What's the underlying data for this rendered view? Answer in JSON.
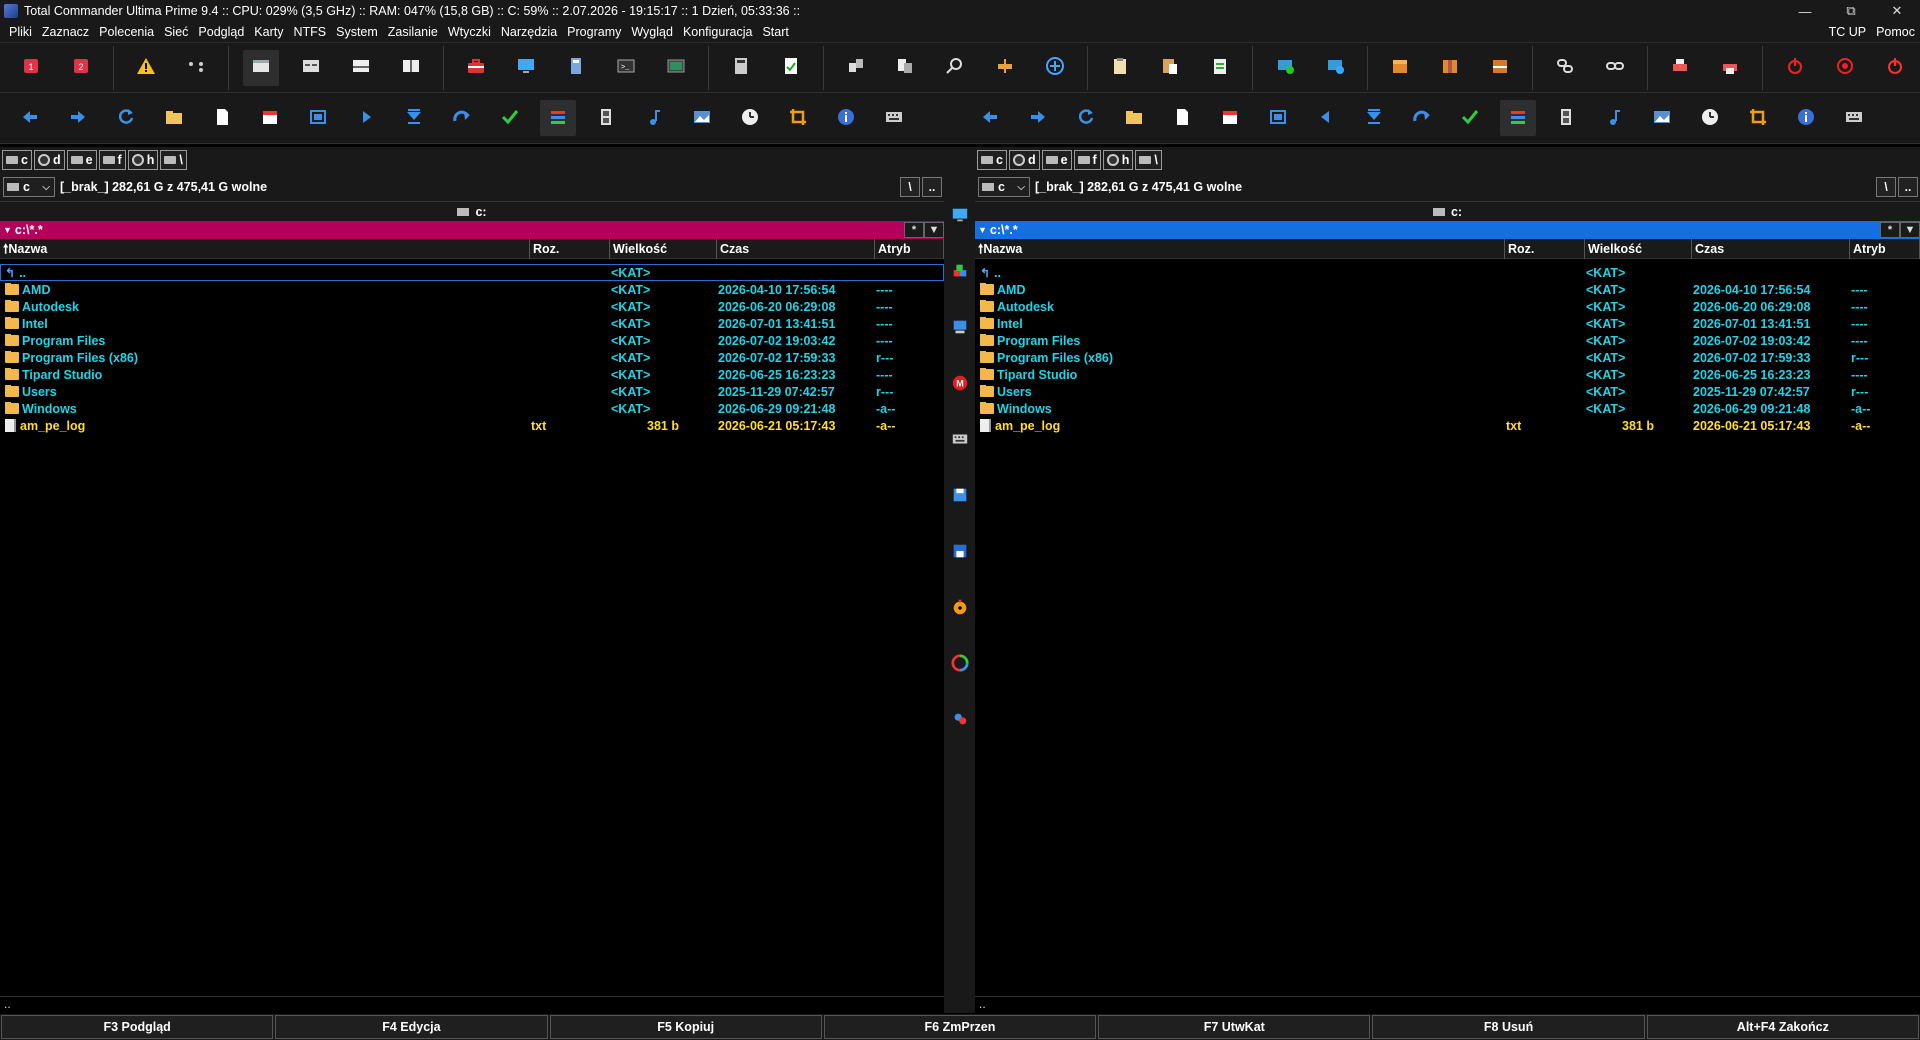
{
  "titlebar": {
    "title": "Total Commander Ultima Prime 9.4 :: CPU: 029% (3,5 GHz) :: RAM: 047% (15,8 GB) :: C: 59% :: 2.07.2026 - 19:15:17 :: 1 Dzień, 05:33:36 ::",
    "min": "—",
    "max": "⧉",
    "close": "✕"
  },
  "menu": {
    "items": [
      "Pliki",
      "Zaznacz",
      "Polecenia",
      "Sieć",
      "Podgląd",
      "Karty",
      "NTFS",
      "System",
      "Zasilanie",
      "Wtyczki",
      "Narzędzia",
      "Programy",
      "Wygląd",
      "Konfiguracja",
      "Start"
    ],
    "right": [
      "TC UP",
      "Pomoc"
    ]
  },
  "left": {
    "drives": [
      "c",
      "d",
      "e",
      "f",
      "h",
      "\\"
    ],
    "drive_select": "c",
    "drive_info": "[_brak_]  282,61 G z 475,41 G wolne",
    "btn_root": "\\",
    "btn_up": "..",
    "header_path": "c:",
    "path": "c:\\*.*",
    "path_btn1": "*",
    "path_btn2": "▼",
    "accent": "#b5005b",
    "columns": {
      "name": "Nazwa",
      "ext": "Roz.",
      "size": "Wielkość",
      "date": "Czas",
      "attr": "Atryb"
    },
    "status": ".."
  },
  "right": {
    "drives": [
      "c",
      "d",
      "e",
      "f",
      "h",
      "\\"
    ],
    "drive_select": "c",
    "drive_info": "[_brak_]  282,61 G z 475,41 G wolne",
    "btn_root": "\\",
    "btn_up": "..",
    "header_path": "c:",
    "path": "c:\\*.*",
    "path_btn1": "*",
    "path_btn2": "▼",
    "accent": "#1470e0",
    "columns": {
      "name": "Nazwa",
      "ext": "Roz.",
      "size": "Wielkość",
      "date": "Czas",
      "attr": "Atryb"
    },
    "status": ".."
  },
  "files": [
    {
      "type": "up",
      "name": "..",
      "ext": "",
      "size": "<KAT>",
      "date": "",
      "attr": ""
    },
    {
      "type": "dir",
      "name": "AMD",
      "ext": "",
      "size": "<KAT>",
      "date": "2026-04-10 17:56:54",
      "attr": "----"
    },
    {
      "type": "dir",
      "name": "Autodesk",
      "ext": "",
      "size": "<KAT>",
      "date": "2026-06-20 06:29:08",
      "attr": "----"
    },
    {
      "type": "dir",
      "name": "Intel",
      "ext": "",
      "size": "<KAT>",
      "date": "2026-07-01 13:41:51",
      "attr": "----"
    },
    {
      "type": "dir",
      "name": "Program Files",
      "ext": "",
      "size": "<KAT>",
      "date": "2026-07-02 19:03:42",
      "attr": "----"
    },
    {
      "type": "dir",
      "name": "Program Files (x86)",
      "ext": "",
      "size": "<KAT>",
      "date": "2026-07-02 17:59:33",
      "attr": "r---"
    },
    {
      "type": "dir",
      "name": "Tipard Studio",
      "ext": "",
      "size": "<KAT>",
      "date": "2026-06-25 16:23:23",
      "attr": "----"
    },
    {
      "type": "dir",
      "name": "Users",
      "ext": "",
      "size": "<KAT>",
      "date": "2025-11-29 07:42:57",
      "attr": "r---"
    },
    {
      "type": "dir",
      "name": "Windows",
      "ext": "",
      "size": "<KAT>",
      "date": "2026-06-29 09:21:48",
      "attr": "-a--"
    },
    {
      "type": "file",
      "name": "am_pe_log",
      "ext": "txt",
      "size": "381 b",
      "date": "2026-06-21 05:17:43",
      "attr": "-a--"
    }
  ],
  "fkeys": [
    "F3 Podgląd",
    "F4 Edycja",
    "F5 Kopiuj",
    "F6 ZmPrzen",
    "F7 UtwKat",
    "F8 Usuń",
    "Alt+F4 Zakończ"
  ],
  "toolbar1_icons": [
    "tab-1-icon",
    "tab-2-icon",
    "warning-icon",
    "dots-icon",
    "brief-view-icon",
    "details-view-icon",
    "thumbnails-view-icon",
    "tree-view-icon",
    "toolbox-icon",
    "monitor-icon",
    "disk-icon",
    "terminal-icon",
    "screen-icon",
    "calculator-icon",
    "notepad-icon",
    "sync-dirs-icon",
    "compare-files-icon",
    "search-icon",
    "multi-rename-icon",
    "add-icon",
    "clipboard-icon",
    "paste-icon",
    "checklist-icon",
    "network-connect-icon",
    "network-disconnect-icon",
    "archive-icon",
    "pack-icon",
    "unpack-icon",
    "link-icon",
    "chain-icon",
    "printer-icon",
    "printer-2-icon",
    "power-icon",
    "record-icon",
    "shutdown-icon"
  ],
  "toolbar2_icons": [
    "back-icon",
    "forward-icon",
    "refresh-icon",
    "folder-icon",
    "file-icon",
    "calendar-icon",
    "select-icon",
    "play-icon",
    "filter-icon",
    "redo-icon",
    "check-icon",
    "color-bars-icon",
    "film-icon",
    "music-icon",
    "image-icon",
    "clock-icon",
    "crop-icon",
    "info-icon",
    "keyboard-icon"
  ],
  "side_icons": [
    "monitor-icon",
    "blocks-icon",
    "computer-icon",
    "m-icon",
    "keyboard-icon",
    "floppy-icon",
    "floppy-2-icon",
    "burn-icon",
    "color-wheel-icon",
    "users-icon"
  ]
}
